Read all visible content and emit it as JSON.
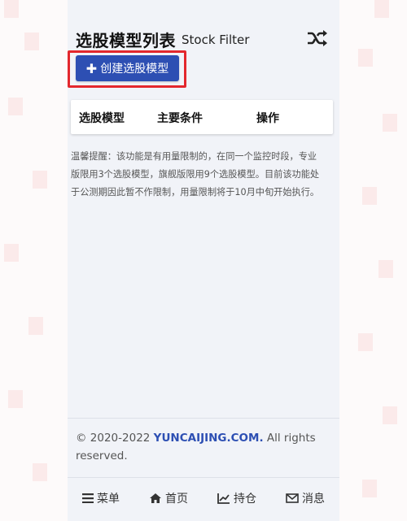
{
  "page": {
    "title": "选股模型列表",
    "subtitle": "Stock Filter",
    "shuffle_icon": "shuffle-icon"
  },
  "actions": {
    "create_label": "创建选股模型",
    "create_icon": "plus-icon"
  },
  "table": {
    "columns": [
      "选股模型",
      "主要条件",
      "操作"
    ],
    "rows": []
  },
  "notice": {
    "lines": [
      "温馨提醒：该功能是有用量限制的，在同一个监控时段，专业",
      "版限用3个选股模型，旗舰版限用9个选股模型。目前该功能处",
      "于公测期因此暂不作限制，用量限制将于10月中旬开始执行。"
    ]
  },
  "footer": {
    "copyright_prefix": "© 2020-2022 ",
    "brand": "YUNCAIJING.COM.",
    "rights_line1": " All rights",
    "rights_line2": "reserved."
  },
  "nav": {
    "items": [
      {
        "label": "菜单",
        "icon": "menu-icon"
      },
      {
        "label": "首页",
        "icon": "home-icon"
      },
      {
        "label": "持仓",
        "icon": "chart-line-icon"
      },
      {
        "label": "消息",
        "icon": "envelope-icon"
      }
    ]
  },
  "colors": {
    "accent": "#2d4fb3",
    "highlight": "#e3272d",
    "panel": "#f1f3f8"
  }
}
